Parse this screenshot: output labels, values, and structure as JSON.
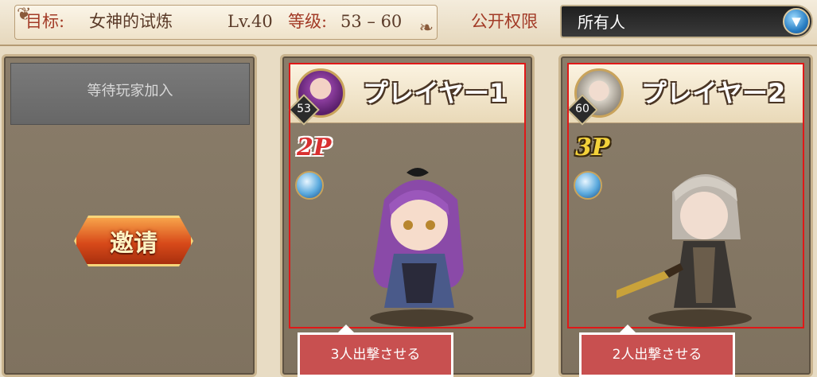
{
  "header": {
    "target_label": "目标:",
    "target_name": "女神的试炼",
    "level": "Lv.40",
    "grade_label": "等级:",
    "grade_range": "53 – 60",
    "access_label": "公开权限",
    "access_value": "所有人",
    "access_dropdown_icon": "chevron-down-icon"
  },
  "slot_empty": {
    "waiting_text": "等待玩家加入",
    "invite_label": "邀请"
  },
  "players": [
    {
      "name": "プレイヤー1",
      "level": "53",
      "slot_tag": "2P",
      "tooltip": "3人出撃させる",
      "element_icon": "water-orb-icon"
    },
    {
      "name": "プレイヤー2",
      "level": "60",
      "slot_tag": "3P",
      "tooltip": "2人出撃させる",
      "element_icon": "water-orb-icon"
    }
  ],
  "colors": {
    "highlight": "#e01818",
    "tooltip_bg": "#c85050",
    "accent_red": "#a23a26"
  }
}
